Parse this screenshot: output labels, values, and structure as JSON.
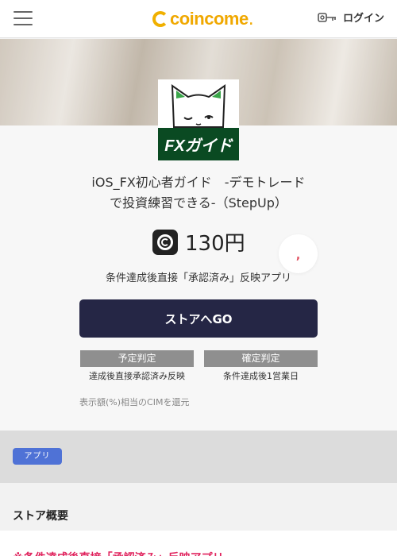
{
  "header": {
    "logo_text": "coincome",
    "logo_dot": ".",
    "login_label": "ログイン",
    "brand_color": "#f0a800"
  },
  "offer": {
    "app_icon_label": "FXガイド",
    "title_line1": "iOS_FX初心者ガイド　-デモトレード",
    "title_line2": "で投資練習できる-（StepUp）",
    "reward_value": "130円",
    "favorite_glyph": ",",
    "condition": "条件達成後直接「承認済み」反映アプリ",
    "store_button_label": "ストアへGO",
    "judges": [
      {
        "head": "予定判定",
        "sub": "達成後直接承認済み反映"
      },
      {
        "head": "確定判定",
        "sub": "条件達成後1営業日"
      }
    ],
    "note": "表示額(%)相当のCIMを還元"
  },
  "tags": [
    "アプリ"
  ],
  "overview": {
    "title": "ストア概要",
    "body_text": "※条件達成後直接「承認済み」反映アプリ"
  },
  "colors": {
    "button_bg": "#252645",
    "tag_bg": "#4f72d6",
    "judge_bg": "#8f8f8f",
    "accent_red": "#e0245e"
  }
}
